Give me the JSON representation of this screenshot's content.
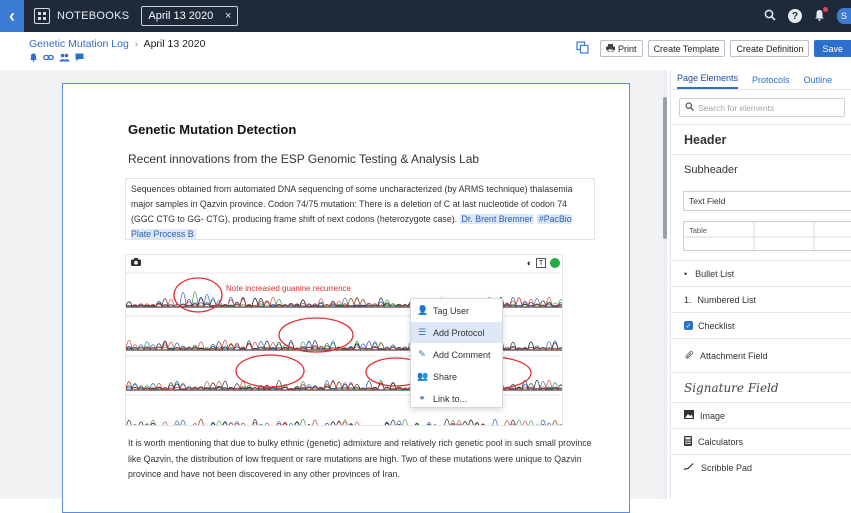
{
  "topbar": {
    "back_label": "‹",
    "notebooks_label": "NOTEBOOKS",
    "tab_label": "April 13 2020",
    "tab_close": "×",
    "search_icon": "search-icon",
    "help_label": "?",
    "bell_icon": "bell-icon",
    "avatar_initial": "S"
  },
  "breadcrumb": {
    "parent": "Genetic Mutation Log",
    "separator": "›",
    "current": "April 13 2020",
    "icons": [
      "bell-icon",
      "link-icon",
      "users-icon",
      "chat-icon"
    ]
  },
  "toolbar": {
    "print_label": "Print",
    "create_template_label": "Create Template",
    "create_definition_label": "Create Definition",
    "save_label": "Save"
  },
  "document": {
    "title": "Genetic Mutation Detection",
    "subtitle": "Recent innovations from the ESP Genomic Testing & Analysis Lab",
    "paragraph1": "Sequences obtained from automated DNA sequencing of some uncharacterized (by ARMS technique) thalasemia major samples in Qazvin province. Codon 74/75 mutation: There is a deletion of C at last nucleotide of codon 74 (GGC CTG to GG- CTG), producing frame shift of next codons (heterozygote case).",
    "mention": "Dr. Brent Bremner",
    "tag": "#PacBio Plate Process B",
    "annotation": "Note increased guanine recurrence",
    "paragraph2": "It is worth mentioning that due to bulky ethnic (genetic) admixture and relatively rich genetic pool in such small province like Qazvin, the distribution of low frequent or rare mutations are high. Two of these mutations were unique to Qazvin province and have not been discovered in any other provinces of Iran."
  },
  "context_menu": {
    "items": [
      {
        "label": "Tag User",
        "icon": "user-icon",
        "glyph": "👤"
      },
      {
        "label": "Add Protocol",
        "icon": "protocol-icon",
        "glyph": "☰"
      },
      {
        "label": "Add Comment",
        "icon": "comment-icon",
        "glyph": "✎"
      },
      {
        "label": "Share",
        "icon": "share-icon",
        "glyph": "👥"
      },
      {
        "label": "Link to...",
        "icon": "link-icon",
        "glyph": "⚭"
      }
    ],
    "active_index": 1
  },
  "panel": {
    "tabs": [
      "Page Elements",
      "Protocols",
      "Outline"
    ],
    "active_tab": 0,
    "search_placeholder": "Search for elements",
    "header_label": "Header",
    "subheader_label": "Subheader",
    "text_field_label": "Text Field",
    "table_label": "Table",
    "bullet_list_label": "Bullet List",
    "bullet_glyph": "•",
    "numbered_list_label": "Numbered List",
    "numbered_prefix": "1.",
    "checklist_label": "Checklist",
    "attachment_label": "Attachment Field",
    "signature_label": "Signature Field",
    "image_label": "Image",
    "calculators_label": "Calculators",
    "scribble_label": "Scribble Pad"
  },
  "colors": {
    "topbar_bg": "#1e2a3a",
    "accent": "#2d6fcc",
    "annotation_red": "#e03030"
  }
}
